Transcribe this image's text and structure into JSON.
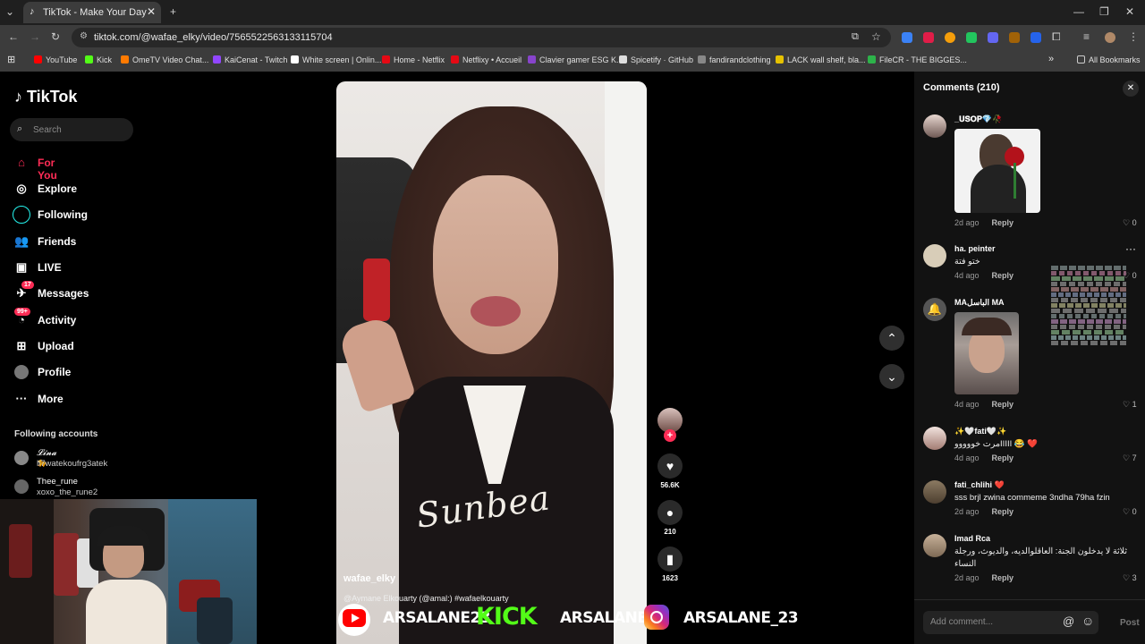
{
  "browser": {
    "tab_title": "TikTok - Make Your Day",
    "new_tab": "+",
    "url": "tiktok.com/@wafae_elky/video/7565522563133115704",
    "bookmarks": [
      {
        "label": "YouTube",
        "color": "#ff0000"
      },
      {
        "label": "Kick",
        "color": "#53fc18"
      },
      {
        "label": "OmeTV Video Chat...",
        "color": "#ff7a00"
      },
      {
        "label": "KaiCenat - Twitch",
        "color": "#9146ff"
      },
      {
        "label": "White screen | Onlin...",
        "color": "#ffffff"
      },
      {
        "label": "Home - Netflix",
        "color": "#e50914"
      },
      {
        "label": "Netflixy • Accueil",
        "color": "#e50914"
      },
      {
        "label": "Clavier gamer ESG K...",
        "color": "#8844cc"
      },
      {
        "label": "Spicetify · GitHub",
        "color": "#dddddd"
      },
      {
        "label": "fandirandclothing",
        "color": "#888888"
      },
      {
        "label": "LACK wall shelf, bla...",
        "color": "#e6c200"
      },
      {
        "label": "FileCR - THE BIGGES...",
        "color": "#2db34a"
      }
    ],
    "all_bookmarks": "All Bookmarks",
    "more_bookmarks": "»"
  },
  "sidebar": {
    "logo": "TikTok",
    "search_placeholder": "Search",
    "items": [
      {
        "label": "For You",
        "icon": "home-icon",
        "active": true
      },
      {
        "label": "Explore",
        "icon": "compass-icon"
      },
      {
        "label": "Following",
        "icon": "following-icon"
      },
      {
        "label": "Friends",
        "icon": "friends-icon"
      },
      {
        "label": "LIVE",
        "icon": "live-icon"
      },
      {
        "label": "Messages",
        "icon": "messages-icon",
        "badge": "17"
      },
      {
        "label": "Activity",
        "icon": "activity-icon",
        "badge": "99+"
      },
      {
        "label": "Upload",
        "icon": "upload-icon"
      },
      {
        "label": "Profile",
        "icon": "profile-icon"
      },
      {
        "label": "More",
        "icon": "more-icon"
      }
    ],
    "following_title": "Following accounts",
    "accounts": [
      {
        "name": "𝓛𝓲𝓷𝓪🐆",
        "handle": "li7watekoufrg3atek"
      },
      {
        "name": "Thee_rune",
        "handle": "xoxo_the_rune2"
      }
    ]
  },
  "video": {
    "author": "wafae_elky",
    "description": "@Aymane Elkouarty (@amal:) #wafaelkouarty",
    "likes": "56.6K",
    "comments": "210",
    "saves": "1623"
  },
  "banner": {
    "youtube": "ARSALANE23",
    "kick_logo": "KICK",
    "kick": "ARSALANE1",
    "instagram": "ARSALANE_23"
  },
  "comments_panel": {
    "title": "Comments (210)",
    "add_placeholder": "Add comment...",
    "post_label": "Post",
    "reply_label": "Reply",
    "items": [
      {
        "user": "_𝐔𝐒𝐎𝐏💎🥀",
        "text": "",
        "time": "2d ago",
        "likes": "0"
      },
      {
        "user": "ha. peinter",
        "text": "ختو فتة",
        "time": "4d ago",
        "likes": "0"
      },
      {
        "user": "MAالباسل MA",
        "text": "",
        "time": "4d ago",
        "likes": "1"
      },
      {
        "user": "✨🤍fati🤍✨",
        "text": "مرت خوووووIIIII 😂 ❤️",
        "time": "4d ago",
        "likes": "7"
      },
      {
        "user": "fati_chlihi ❤️",
        "text": "sss brjl zwina commeme 3ndha 79ha fzin",
        "time": "2d ago",
        "likes": "0"
      },
      {
        "user": "Imad Rca",
        "text": "ثلاثة لا يدخلون الجنة: العاقلوالديه، والديوث، ورجلة",
        "text2": "النساء",
        "time": "2d ago",
        "likes": "3"
      }
    ]
  },
  "colors": {
    "accent": "#fe2c55",
    "kick": "#53fc18"
  }
}
